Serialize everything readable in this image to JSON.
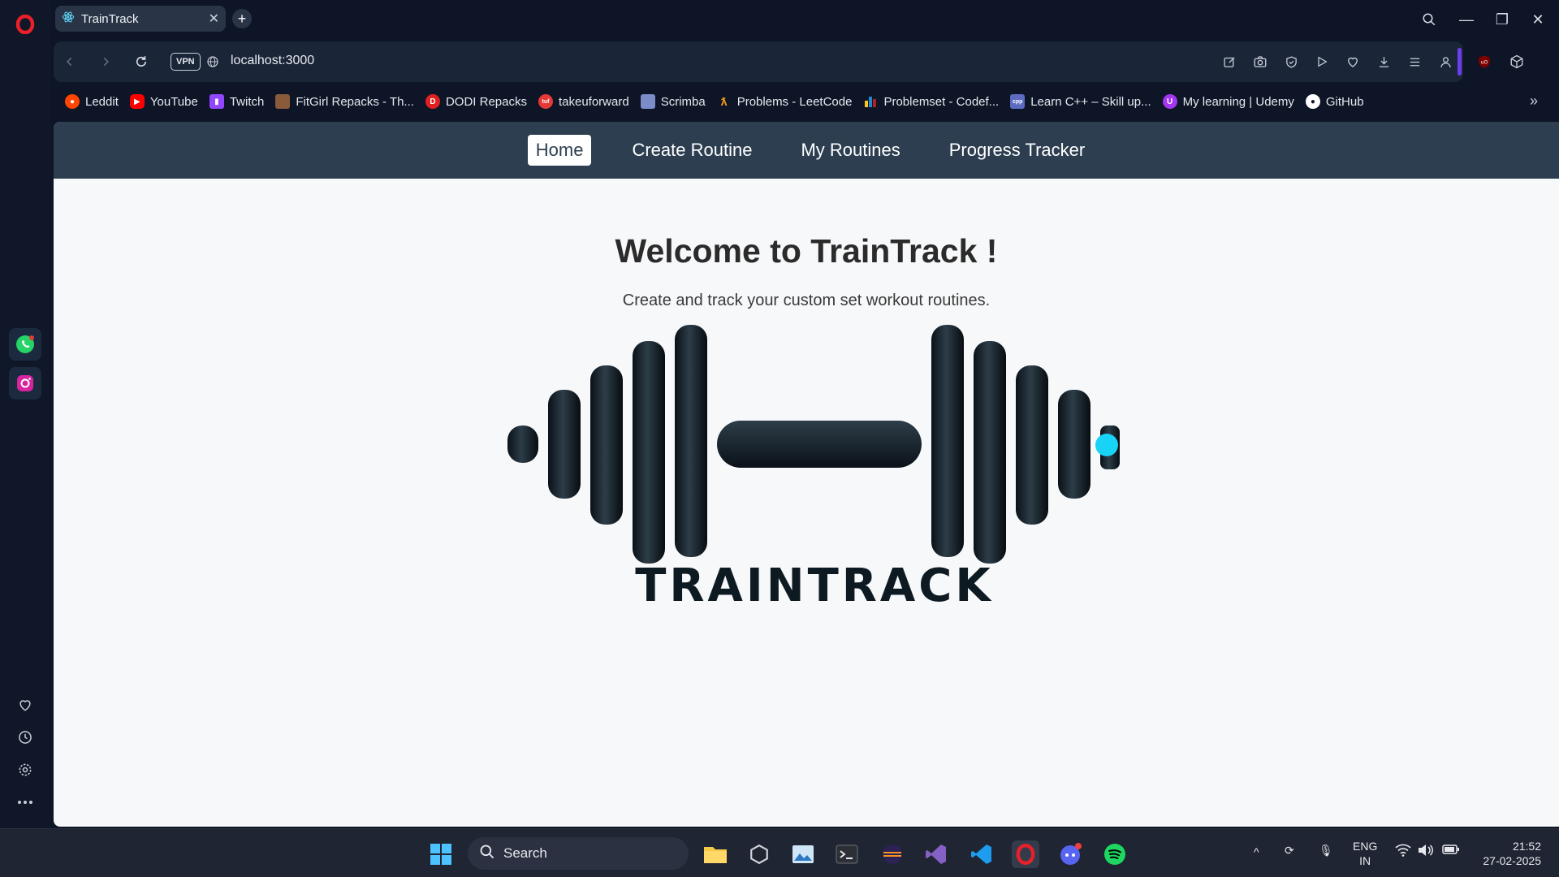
{
  "browser": {
    "tab_title": "TrainTrack",
    "url": "localhost:3000",
    "vpn_label": "VPN",
    "accent_color": "#6b3ff0"
  },
  "bookmarks": [
    {
      "label": "Leddit",
      "icon": "reddit-icon",
      "color": "#ff4500"
    },
    {
      "label": "YouTube",
      "icon": "youtube-icon",
      "color": "#ff0000"
    },
    {
      "label": "Twitch",
      "icon": "twitch-icon",
      "color": "#9146ff"
    },
    {
      "label": "FitGirl Repacks - Th...",
      "icon": "fitgirl-icon",
      "color": "#8a5a3c"
    },
    {
      "label": "DODI Repacks",
      "icon": "dodi-icon",
      "color": "#e02020"
    },
    {
      "label": "takeuforward",
      "icon": "tuf-icon",
      "color": "#e53935"
    },
    {
      "label": "Scrimba",
      "icon": "scrimba-icon",
      "color": "#7b8cc9"
    },
    {
      "label": "Problems - LeetCode",
      "icon": "leetcode-icon",
      "color": "#f89f1b"
    },
    {
      "label": "Problemset - Codef...",
      "icon": "codeforces-icon",
      "color": "#1f8acb"
    },
    {
      "label": "Learn C++ – Skill up...",
      "icon": "cpp-icon",
      "color": "#5c6bc0"
    },
    {
      "label": "My learning | Udemy",
      "icon": "udemy-icon",
      "color": "#a435f0"
    },
    {
      "label": "GitHub",
      "icon": "github-icon",
      "color": "#ffffff"
    }
  ],
  "app": {
    "nav": [
      {
        "label": "Home",
        "active": true
      },
      {
        "label": "Create Routine",
        "active": false
      },
      {
        "label": "My Routines",
        "active": false
      },
      {
        "label": "Progress Tracker",
        "active": false
      }
    ],
    "hero_title": "Welcome to TrainTrack !",
    "hero_subtitle": "Create and track your custom set workout routines.",
    "logo_text": "TRAINTRACK",
    "nav_bg": "#2c3e50"
  },
  "taskbar": {
    "search_label": "Search",
    "lang_top": "ENG",
    "lang_bottom": "IN",
    "time": "21:52",
    "date": "27-02-2025"
  }
}
